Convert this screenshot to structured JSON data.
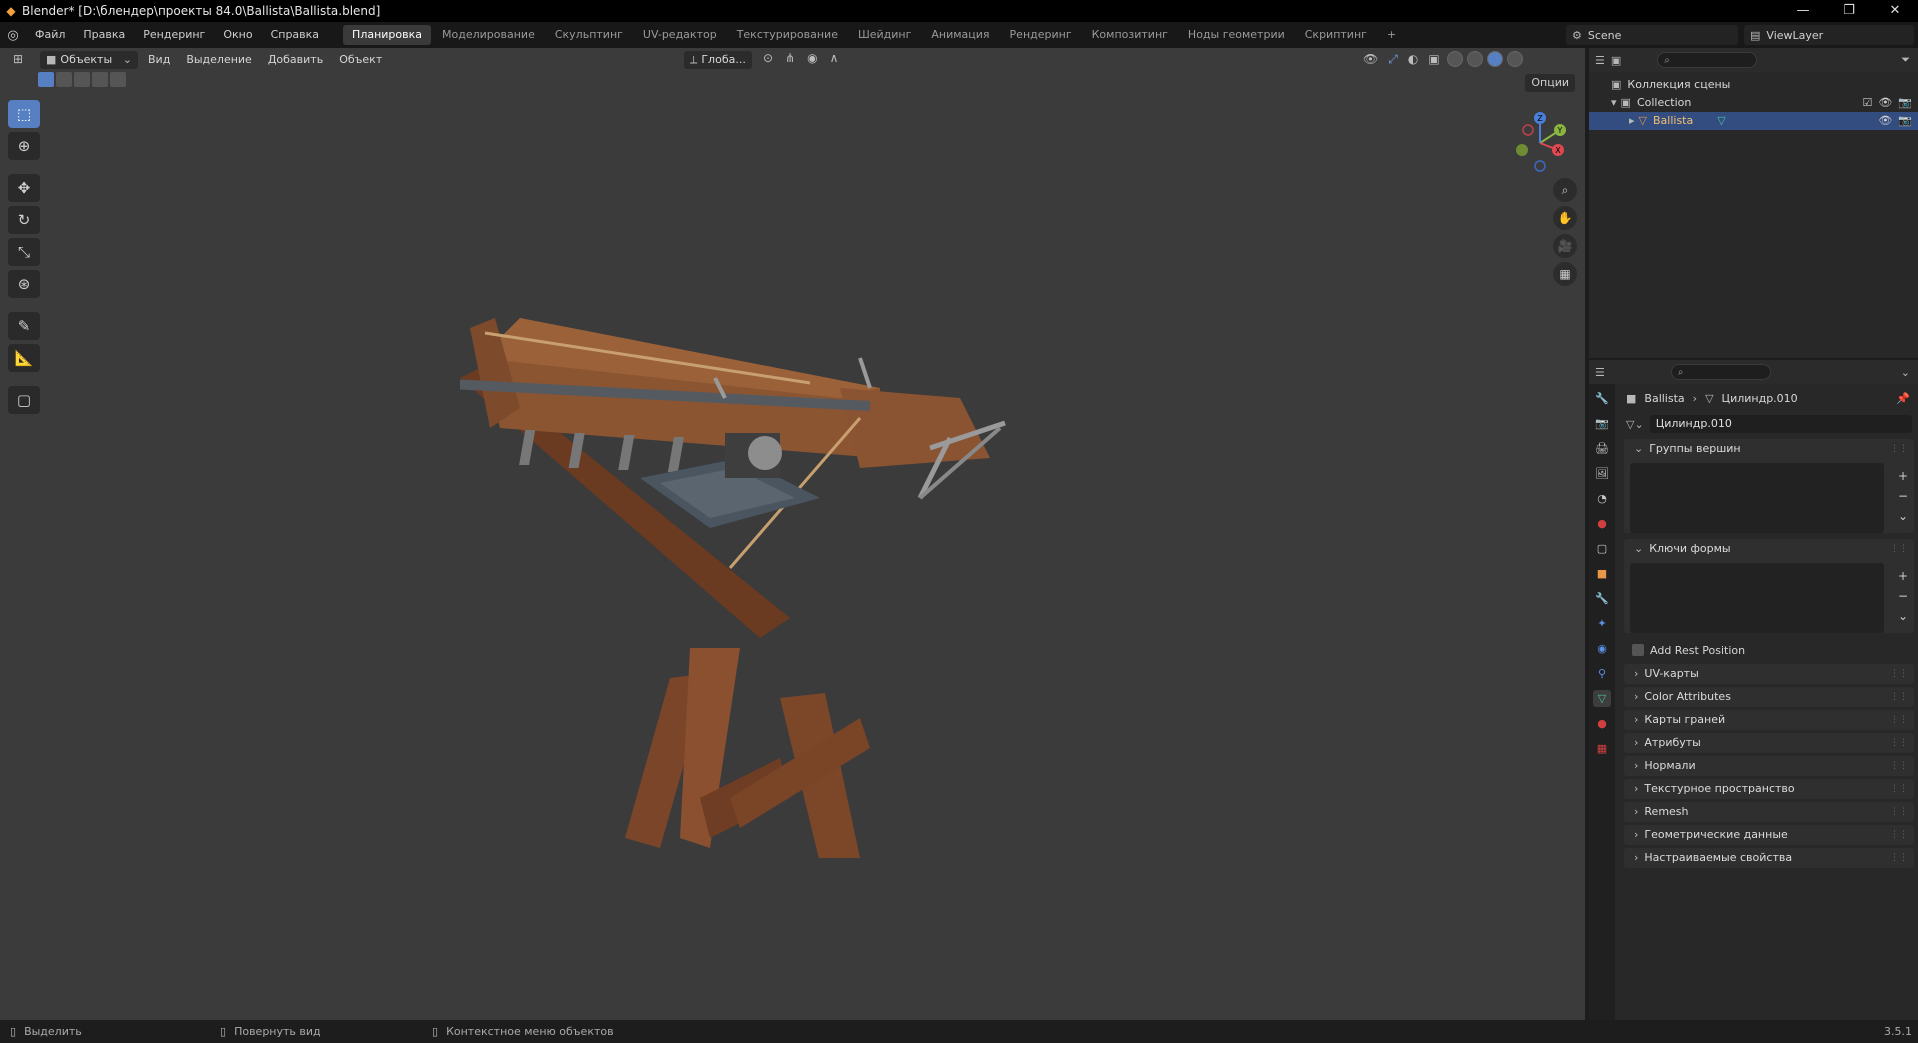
{
  "window": {
    "title": "Blender* [D:\\блендер\\проекты 84.0\\Ballista\\Ballista.blend]",
    "controls": [
      "—",
      "❐",
      "✕"
    ]
  },
  "menu": {
    "items": [
      "Файл",
      "Правка",
      "Рендеринг",
      "Окно",
      "Справка"
    ]
  },
  "workspaces": [
    {
      "label": "Планировка",
      "active": true
    },
    {
      "label": "Моделирование"
    },
    {
      "label": "Скульптинг"
    },
    {
      "label": "UV-редактор"
    },
    {
      "label": "Текстурирование"
    },
    {
      "label": "Шейдинг"
    },
    {
      "label": "Анимация"
    },
    {
      "label": "Рендеринг"
    },
    {
      "label": "Композитинг"
    },
    {
      "label": "Ноды геометрии"
    },
    {
      "label": "Скриптинг"
    }
  ],
  "add_workspace": "+",
  "scene": {
    "label": "Scene"
  },
  "view_layer": {
    "label": "ViewLayer"
  },
  "viewport": {
    "mode": "Объекты",
    "menus": [
      "Вид",
      "Выделение",
      "Добавить",
      "Объект"
    ],
    "orientation": "Глоба...",
    "options": "Опции",
    "gizmo": {
      "x": "X",
      "y": "Y",
      "z": "Z"
    }
  },
  "outliner": {
    "scene_collection": "Коллекция сцены",
    "collection": "Collection",
    "object": "Ballista"
  },
  "properties": {
    "breadcrumb_object": "Ballista",
    "breadcrumb_mesh": "Цилиндр.010",
    "mesh_name": "Цилиндр.010",
    "vertex_groups": "Группы вершин",
    "shape_keys": "Ключи формы",
    "add_rest_position": "Add Rest Position",
    "sections": [
      "UV-карты",
      "Color Attributes",
      "Карты граней",
      "Атрибуты",
      "Нормали",
      "Текстурное пространство",
      "Remesh",
      "Геометрические данные",
      "Настраиваемые свойства"
    ]
  },
  "status": {
    "select": "Выделить",
    "rotate": "Повернуть вид",
    "context": "Контекстное меню объектов",
    "version": "3.5.1"
  }
}
